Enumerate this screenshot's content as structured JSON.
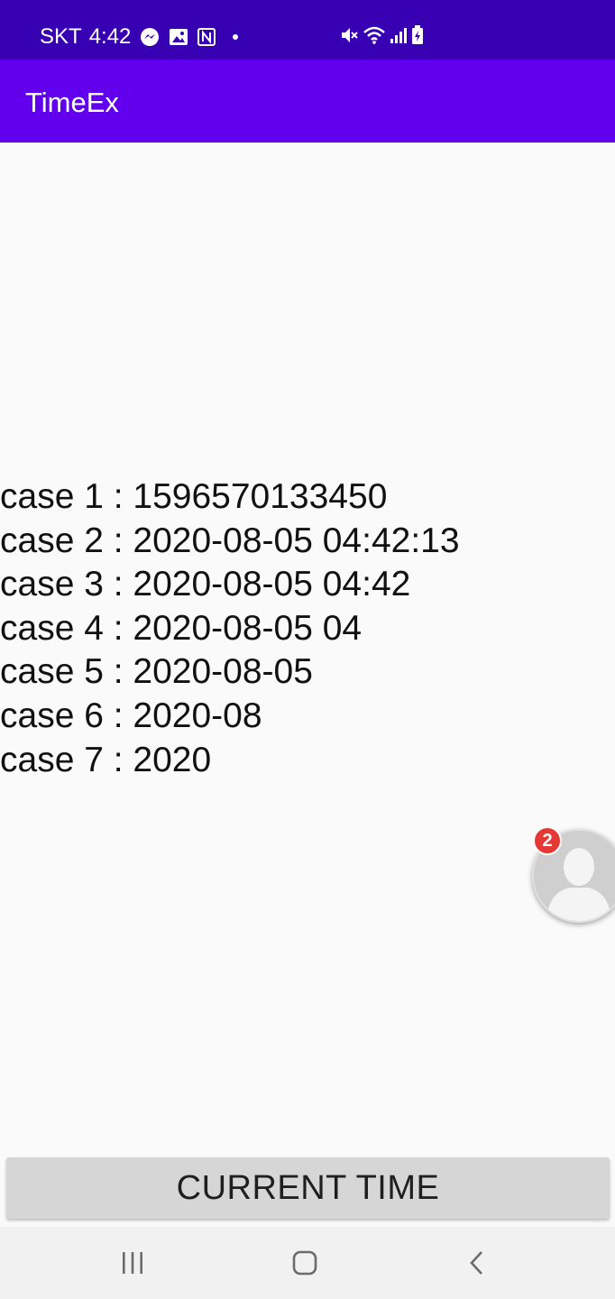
{
  "status_bar": {
    "carrier": "SKT",
    "time": "4:42",
    "left_icons": [
      "messenger-icon",
      "gallery-icon",
      "nfc-icon",
      "dot-icon"
    ],
    "right_icons": [
      "mute-icon",
      "wifi-icon",
      "signal-icon",
      "battery-charging-icon"
    ]
  },
  "app_bar": {
    "title": "TimeEx"
  },
  "cases": [
    "case 1 : 1596570133450",
    "case 2 : 2020-08-05 04:42:13",
    "case 3 : 2020-08-05 04:42",
    "case 4 : 2020-08-05 04",
    "case 5 : 2020-08-05",
    "case 6 : 2020-08",
    "case 7 : 2020"
  ],
  "chat_head": {
    "badge_count": "2"
  },
  "button": {
    "label": "CURRENT TIME"
  },
  "nav_bar": {
    "icons": [
      "recents-icon",
      "home-icon",
      "back-icon"
    ]
  },
  "colors": {
    "status_bar": "#3700b3",
    "app_bar": "#6200ee",
    "background": "#fafafa",
    "button": "#d6d6d6"
  }
}
